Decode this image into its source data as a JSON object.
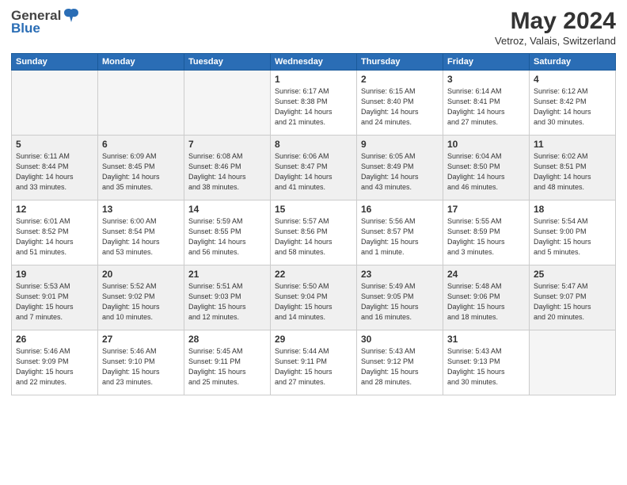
{
  "header": {
    "logo_general": "General",
    "logo_blue": "Blue",
    "month": "May 2024",
    "location": "Vetroz, Valais, Switzerland"
  },
  "weekdays": [
    "Sunday",
    "Monday",
    "Tuesday",
    "Wednesday",
    "Thursday",
    "Friday",
    "Saturday"
  ],
  "weeks": [
    [
      {
        "day": "",
        "info": ""
      },
      {
        "day": "",
        "info": ""
      },
      {
        "day": "",
        "info": ""
      },
      {
        "day": "1",
        "info": "Sunrise: 6:17 AM\nSunset: 8:38 PM\nDaylight: 14 hours\nand 21 minutes."
      },
      {
        "day": "2",
        "info": "Sunrise: 6:15 AM\nSunset: 8:40 PM\nDaylight: 14 hours\nand 24 minutes."
      },
      {
        "day": "3",
        "info": "Sunrise: 6:14 AM\nSunset: 8:41 PM\nDaylight: 14 hours\nand 27 minutes."
      },
      {
        "day": "4",
        "info": "Sunrise: 6:12 AM\nSunset: 8:42 PM\nDaylight: 14 hours\nand 30 minutes."
      }
    ],
    [
      {
        "day": "5",
        "info": "Sunrise: 6:11 AM\nSunset: 8:44 PM\nDaylight: 14 hours\nand 33 minutes."
      },
      {
        "day": "6",
        "info": "Sunrise: 6:09 AM\nSunset: 8:45 PM\nDaylight: 14 hours\nand 35 minutes."
      },
      {
        "day": "7",
        "info": "Sunrise: 6:08 AM\nSunset: 8:46 PM\nDaylight: 14 hours\nand 38 minutes."
      },
      {
        "day": "8",
        "info": "Sunrise: 6:06 AM\nSunset: 8:47 PM\nDaylight: 14 hours\nand 41 minutes."
      },
      {
        "day": "9",
        "info": "Sunrise: 6:05 AM\nSunset: 8:49 PM\nDaylight: 14 hours\nand 43 minutes."
      },
      {
        "day": "10",
        "info": "Sunrise: 6:04 AM\nSunset: 8:50 PM\nDaylight: 14 hours\nand 46 minutes."
      },
      {
        "day": "11",
        "info": "Sunrise: 6:02 AM\nSunset: 8:51 PM\nDaylight: 14 hours\nand 48 minutes."
      }
    ],
    [
      {
        "day": "12",
        "info": "Sunrise: 6:01 AM\nSunset: 8:52 PM\nDaylight: 14 hours\nand 51 minutes."
      },
      {
        "day": "13",
        "info": "Sunrise: 6:00 AM\nSunset: 8:54 PM\nDaylight: 14 hours\nand 53 minutes."
      },
      {
        "day": "14",
        "info": "Sunrise: 5:59 AM\nSunset: 8:55 PM\nDaylight: 14 hours\nand 56 minutes."
      },
      {
        "day": "15",
        "info": "Sunrise: 5:57 AM\nSunset: 8:56 PM\nDaylight: 14 hours\nand 58 minutes."
      },
      {
        "day": "16",
        "info": "Sunrise: 5:56 AM\nSunset: 8:57 PM\nDaylight: 15 hours\nand 1 minute."
      },
      {
        "day": "17",
        "info": "Sunrise: 5:55 AM\nSunset: 8:59 PM\nDaylight: 15 hours\nand 3 minutes."
      },
      {
        "day": "18",
        "info": "Sunrise: 5:54 AM\nSunset: 9:00 PM\nDaylight: 15 hours\nand 5 minutes."
      }
    ],
    [
      {
        "day": "19",
        "info": "Sunrise: 5:53 AM\nSunset: 9:01 PM\nDaylight: 15 hours\nand 7 minutes."
      },
      {
        "day": "20",
        "info": "Sunrise: 5:52 AM\nSunset: 9:02 PM\nDaylight: 15 hours\nand 10 minutes."
      },
      {
        "day": "21",
        "info": "Sunrise: 5:51 AM\nSunset: 9:03 PM\nDaylight: 15 hours\nand 12 minutes."
      },
      {
        "day": "22",
        "info": "Sunrise: 5:50 AM\nSunset: 9:04 PM\nDaylight: 15 hours\nand 14 minutes."
      },
      {
        "day": "23",
        "info": "Sunrise: 5:49 AM\nSunset: 9:05 PM\nDaylight: 15 hours\nand 16 minutes."
      },
      {
        "day": "24",
        "info": "Sunrise: 5:48 AM\nSunset: 9:06 PM\nDaylight: 15 hours\nand 18 minutes."
      },
      {
        "day": "25",
        "info": "Sunrise: 5:47 AM\nSunset: 9:07 PM\nDaylight: 15 hours\nand 20 minutes."
      }
    ],
    [
      {
        "day": "26",
        "info": "Sunrise: 5:46 AM\nSunset: 9:09 PM\nDaylight: 15 hours\nand 22 minutes."
      },
      {
        "day": "27",
        "info": "Sunrise: 5:46 AM\nSunset: 9:10 PM\nDaylight: 15 hours\nand 23 minutes."
      },
      {
        "day": "28",
        "info": "Sunrise: 5:45 AM\nSunset: 9:11 PM\nDaylight: 15 hours\nand 25 minutes."
      },
      {
        "day": "29",
        "info": "Sunrise: 5:44 AM\nSunset: 9:11 PM\nDaylight: 15 hours\nand 27 minutes."
      },
      {
        "day": "30",
        "info": "Sunrise: 5:43 AM\nSunset: 9:12 PM\nDaylight: 15 hours\nand 28 minutes."
      },
      {
        "day": "31",
        "info": "Sunrise: 5:43 AM\nSunset: 9:13 PM\nDaylight: 15 hours\nand 30 minutes."
      },
      {
        "day": "",
        "info": ""
      }
    ]
  ]
}
